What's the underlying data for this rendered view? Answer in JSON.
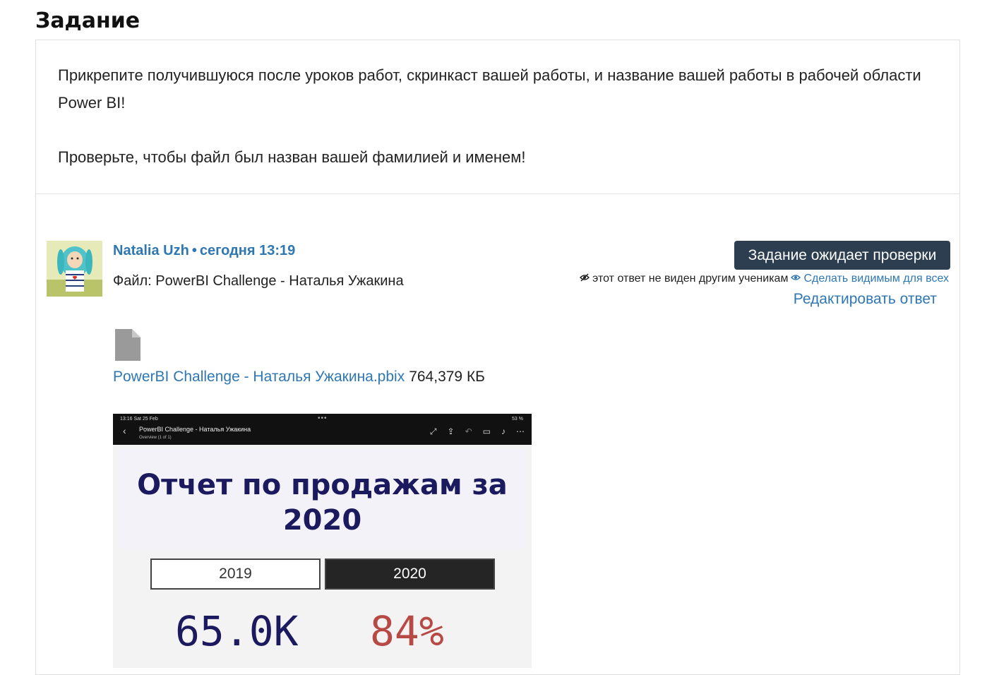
{
  "page_title": "Задание",
  "task": {
    "paragraph_1": "Прикрепите получившуюся после уроков работ, скринкаст вашей работы, и название вашей работы в рабочей области Power BI!",
    "paragraph_2": "Проверьте, чтобы файл был назван вашей фамилией и именем!"
  },
  "answer": {
    "author": "Natalia Uzh",
    "separator": "•",
    "time": "сегодня 13:19",
    "file_line": "Файл: PowerBI Challenge - Наталья Ужакина",
    "status": "Задание ожидает проверки",
    "visibility_note": "этот ответ не виден другим ученикам",
    "make_visible": "Сделать видимым для всех",
    "edit": "Редактировать ответ",
    "attachment": {
      "name": "PowerBI Challenge - Наталья Ужакина.pbix",
      "size": "764,379 КБ"
    }
  },
  "preview": {
    "status_time": "13:16  Sat 25 Feb",
    "battery": "53 %",
    "doc_title": "PowerBI Challenge - Наталья Ужакина",
    "doc_sub": "Overview (1 of 1)",
    "report_title": "Отчет по продажам за 2020",
    "year_1": "2019",
    "year_2": "2020",
    "kpi_1": "65.0K",
    "kpi_2": "84%"
  },
  "colors": {
    "link": "#2f77b3",
    "badge": "#2c3e50",
    "kpi_blue": "#1c1a5e",
    "kpi_red": "#b84a45"
  }
}
